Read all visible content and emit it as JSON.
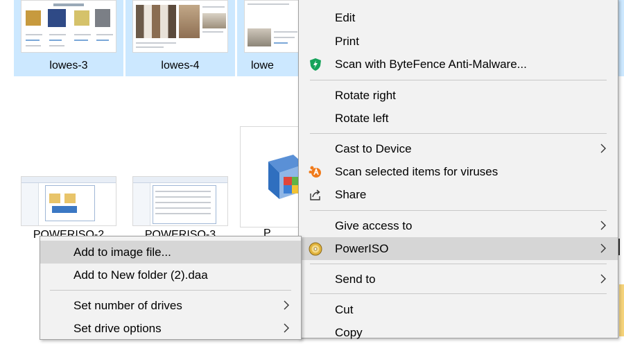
{
  "files": [
    {
      "label": "lowes-3",
      "selected": true
    },
    {
      "label": "lowes-4",
      "selected": true
    },
    {
      "label": "lowe",
      "selected": true
    },
    {
      "label": "POWERISO-2",
      "selected": false
    },
    {
      "label": "POWERISO-3",
      "selected": false
    },
    {
      "label": "P",
      "selected": false
    }
  ],
  "thumbs": {
    "lowes3_heading": "Boxes Tot Integrated",
    "lowes4_heading": "Featured Products"
  },
  "main_menu": {
    "items": [
      {
        "label": "Edit"
      },
      {
        "label": "Print"
      },
      {
        "label": "Scan with ByteFence Anti-Malware...",
        "icon": "bytefence-shield-icon"
      },
      {
        "label": "Rotate right"
      },
      {
        "label": "Rotate left"
      },
      {
        "label": "Cast to Device",
        "submenu": true
      },
      {
        "label": "Scan selected items for viruses",
        "icon": "avast-icon"
      },
      {
        "label": "Share",
        "icon": "share-icon"
      },
      {
        "label": "Give access to",
        "submenu": true
      },
      {
        "label": "PowerISO",
        "icon": "poweriso-disc-icon",
        "submenu": true,
        "highlighted": true
      },
      {
        "label": "Send to",
        "submenu": true
      },
      {
        "label": "Cut"
      },
      {
        "label": "Copy"
      }
    ]
  },
  "poweriso_submenu": {
    "items": [
      {
        "label": "Add to image file...",
        "highlighted": true
      },
      {
        "label": "Add to New folder (2).daa"
      },
      {
        "label": "Set number of drives",
        "submenu": true
      },
      {
        "label": "Set drive options",
        "submenu": true
      }
    ]
  },
  "colors": {
    "selection": "#cce8ff",
    "menu_bg": "#f2f2f2",
    "menu_highlight": "#d6d6d6",
    "bytefence_green": "#16a35a",
    "avast_orange": "#f07a1a"
  }
}
